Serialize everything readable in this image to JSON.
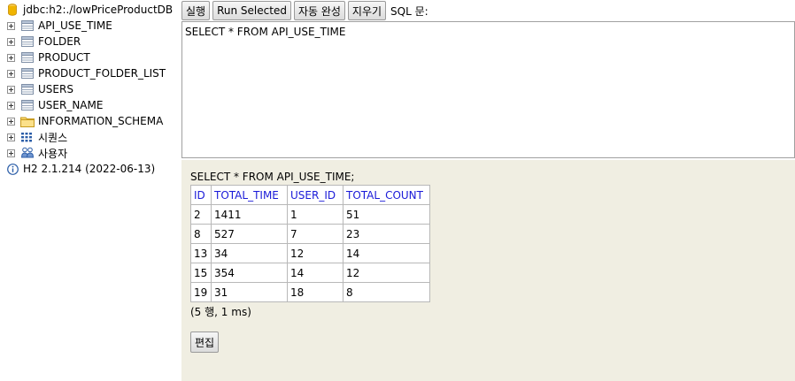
{
  "tree": {
    "connection": "jdbc:h2:./lowPriceProductDB",
    "items": [
      {
        "label": "API_USE_TIME",
        "icon": "table-icon"
      },
      {
        "label": "FOLDER",
        "icon": "table-icon"
      },
      {
        "label": "PRODUCT",
        "icon": "table-icon"
      },
      {
        "label": "PRODUCT_FOLDER_LIST",
        "icon": "table-icon"
      },
      {
        "label": "USERS",
        "icon": "table-icon"
      },
      {
        "label": "USER_NAME",
        "icon": "table-icon"
      },
      {
        "label": "INFORMATION_SCHEMA",
        "icon": "folder-icon"
      },
      {
        "label": "시퀀스",
        "icon": "sequence-icon"
      },
      {
        "label": "사용자",
        "icon": "users-icon"
      }
    ],
    "version": "H2 2.1.214 (2022-06-13)"
  },
  "toolbar": {
    "run": "실행",
    "run_selected": "Run Selected",
    "autocomplete": "자동 완성",
    "clear": "지우기",
    "sql_label": "SQL 문:"
  },
  "editor": {
    "text": "SELECT * FROM API_USE_TIME"
  },
  "result": {
    "query": "SELECT * FROM API_USE_TIME;",
    "columns": [
      "ID",
      "TOTAL_TIME",
      "USER_ID",
      "TOTAL_COUNT"
    ],
    "rows": [
      [
        "2",
        "1411",
        "1",
        "51"
      ],
      [
        "8",
        "527",
        "7",
        "23"
      ],
      [
        "13",
        "34",
        "12",
        "14"
      ],
      [
        "15",
        "354",
        "14",
        "12"
      ],
      [
        "19",
        "31",
        "18",
        "8"
      ]
    ],
    "row_count": "(5 행, 1 ms)",
    "edit_button": "편집"
  },
  "colors": {
    "result_background": "#f0eee2",
    "header_text": "#1a1ad8",
    "db_icon": "#f0b400",
    "table_icon_border": "#7f8fa6"
  }
}
